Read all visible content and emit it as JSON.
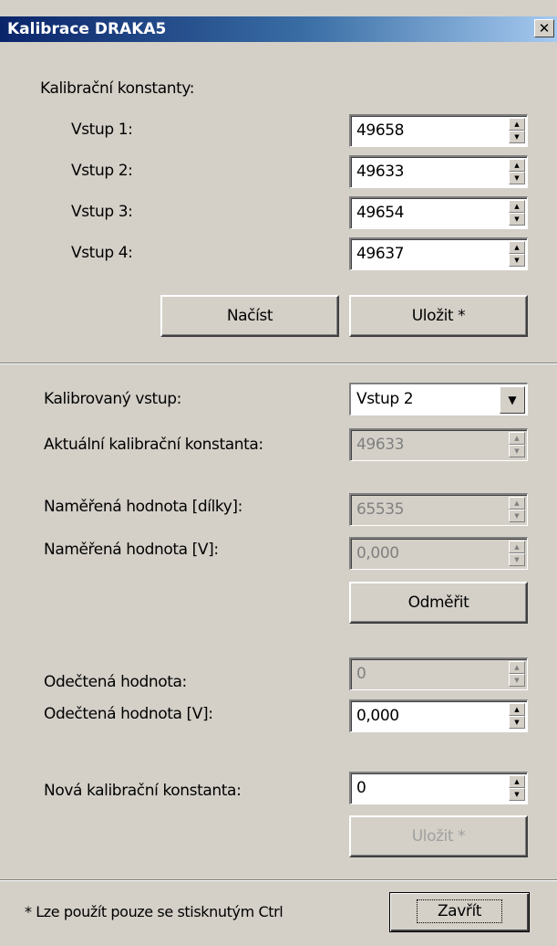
{
  "window": {
    "title": "Kalibrace DRAKA5",
    "close_glyph": "✕"
  },
  "constants": {
    "heading": "Kalibrační konstanty:",
    "inputs": [
      {
        "label": "Vstup 1:",
        "value": "49658"
      },
      {
        "label": "Vstup 2:",
        "value": "49633"
      },
      {
        "label": "Vstup 3:",
        "value": "49654"
      },
      {
        "label": "Vstup 4:",
        "value": "49637"
      }
    ],
    "load_label": "Načíst",
    "save_label": "Uložit *"
  },
  "calibration": {
    "input_label": "Kalibrovaný vstup:",
    "input_selected": "Vstup 2",
    "current_label": "Aktuální kalibrační konstanta:",
    "current_value": "49633",
    "measured_units_label": "Naměřená hodnota [dílky]:",
    "measured_units_value": "65535",
    "measured_v_label": "Naměřená hodnota [V]:",
    "measured_v_value": "0,000",
    "measure_label": "Odměřit",
    "read_label": "Odečtená hodnota:",
    "read_value": "0",
    "read_v_label": "Odečtená hodnota [V]:",
    "read_v_value": "0,000",
    "new_label": "Nová kalibrační konstanta:",
    "new_value": "0",
    "save_label": "Uložit *"
  },
  "footer": {
    "note": "* Lze použít pouze se stisknutým Ctrl",
    "close_label": "Zavřít"
  },
  "glyphs": {
    "up": "▲",
    "down": "▼"
  }
}
